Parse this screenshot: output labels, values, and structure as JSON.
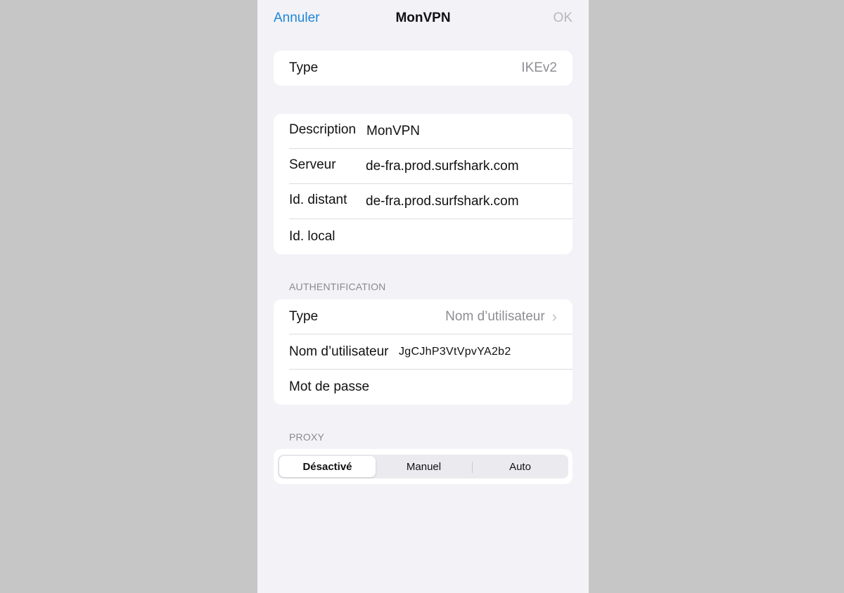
{
  "navbar": {
    "cancel_label": "Annuler",
    "title": "MonVPN",
    "ok_label": "OK"
  },
  "type_group": {
    "label": "Type",
    "value": "IKEv2"
  },
  "config_group": {
    "description_label": "Description",
    "description_value": "MonVPN",
    "server_label": "Serveur",
    "server_value": "de-fra.prod.surfshark.com",
    "remote_id_label": "Id. distant",
    "remote_id_value": "de-fra.prod.surfshark.com",
    "local_id_label": "Id. local",
    "local_id_value": ""
  },
  "auth": {
    "header": "AUTHENTIFICATION",
    "type_label": "Type",
    "type_value": "Nom d’utilisateur",
    "username_label": "Nom d’utilisateur",
    "username_value": "JgCJhP3VtVpvYA2b2",
    "password_label": "Mot de passe",
    "password_value": ""
  },
  "proxy": {
    "header": "PROXY",
    "options": [
      "Désactivé",
      "Manuel",
      "Auto"
    ],
    "selected": "Désactivé"
  },
  "colors": {
    "accent": "#1f87d8",
    "disabled": "#b9b9bd",
    "background": "#f2f2f7"
  }
}
